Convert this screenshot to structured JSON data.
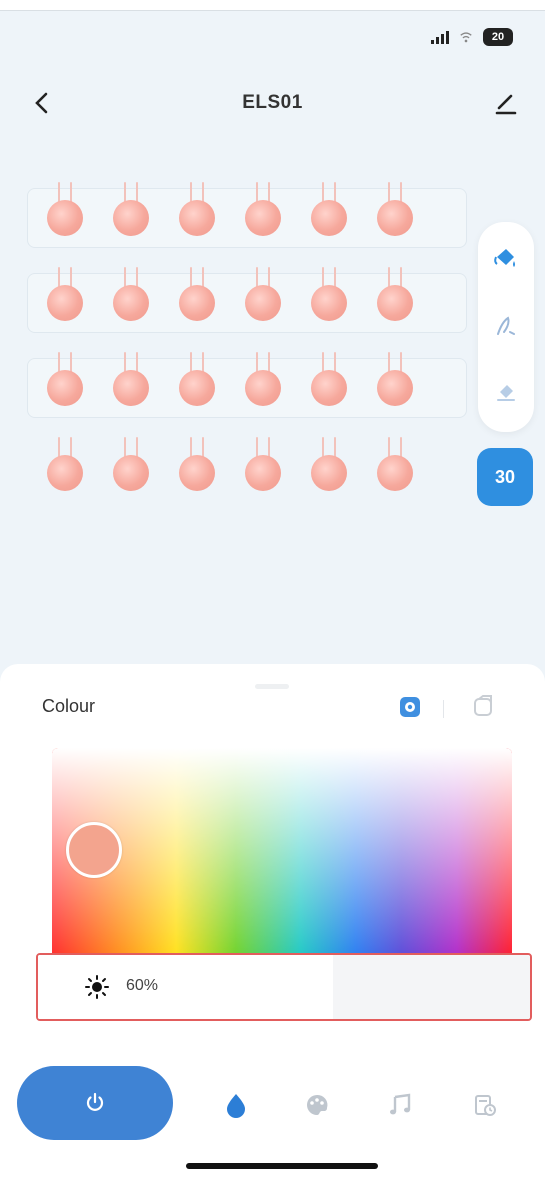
{
  "status_bar": {
    "battery": "20"
  },
  "header": {
    "title": "ELS01",
    "back_icon": "chevron-left-icon",
    "edit_icon": "pencil-icon"
  },
  "lights": {
    "rows": 4,
    "per_row": 6,
    "color": "#f6a89c"
  },
  "tools": [
    {
      "name": "fill-bucket-icon",
      "active": true
    },
    {
      "name": "brush-icon",
      "active": false
    },
    {
      "name": "eraser-icon",
      "active": false
    }
  ],
  "count_badge": "30",
  "colour_panel": {
    "title": "Colour",
    "mode_icons": [
      "colour-wheel-icon",
      "white-light-icon"
    ],
    "selected_colour": "#f3a48e",
    "brightness_value": 0.6,
    "brightness_label": "60%"
  },
  "bottom_nav": {
    "items": [
      "power-icon",
      "colour-drop-icon",
      "palette-icon",
      "music-icon",
      "timer-icon"
    ],
    "accent": "#3f83d4"
  }
}
